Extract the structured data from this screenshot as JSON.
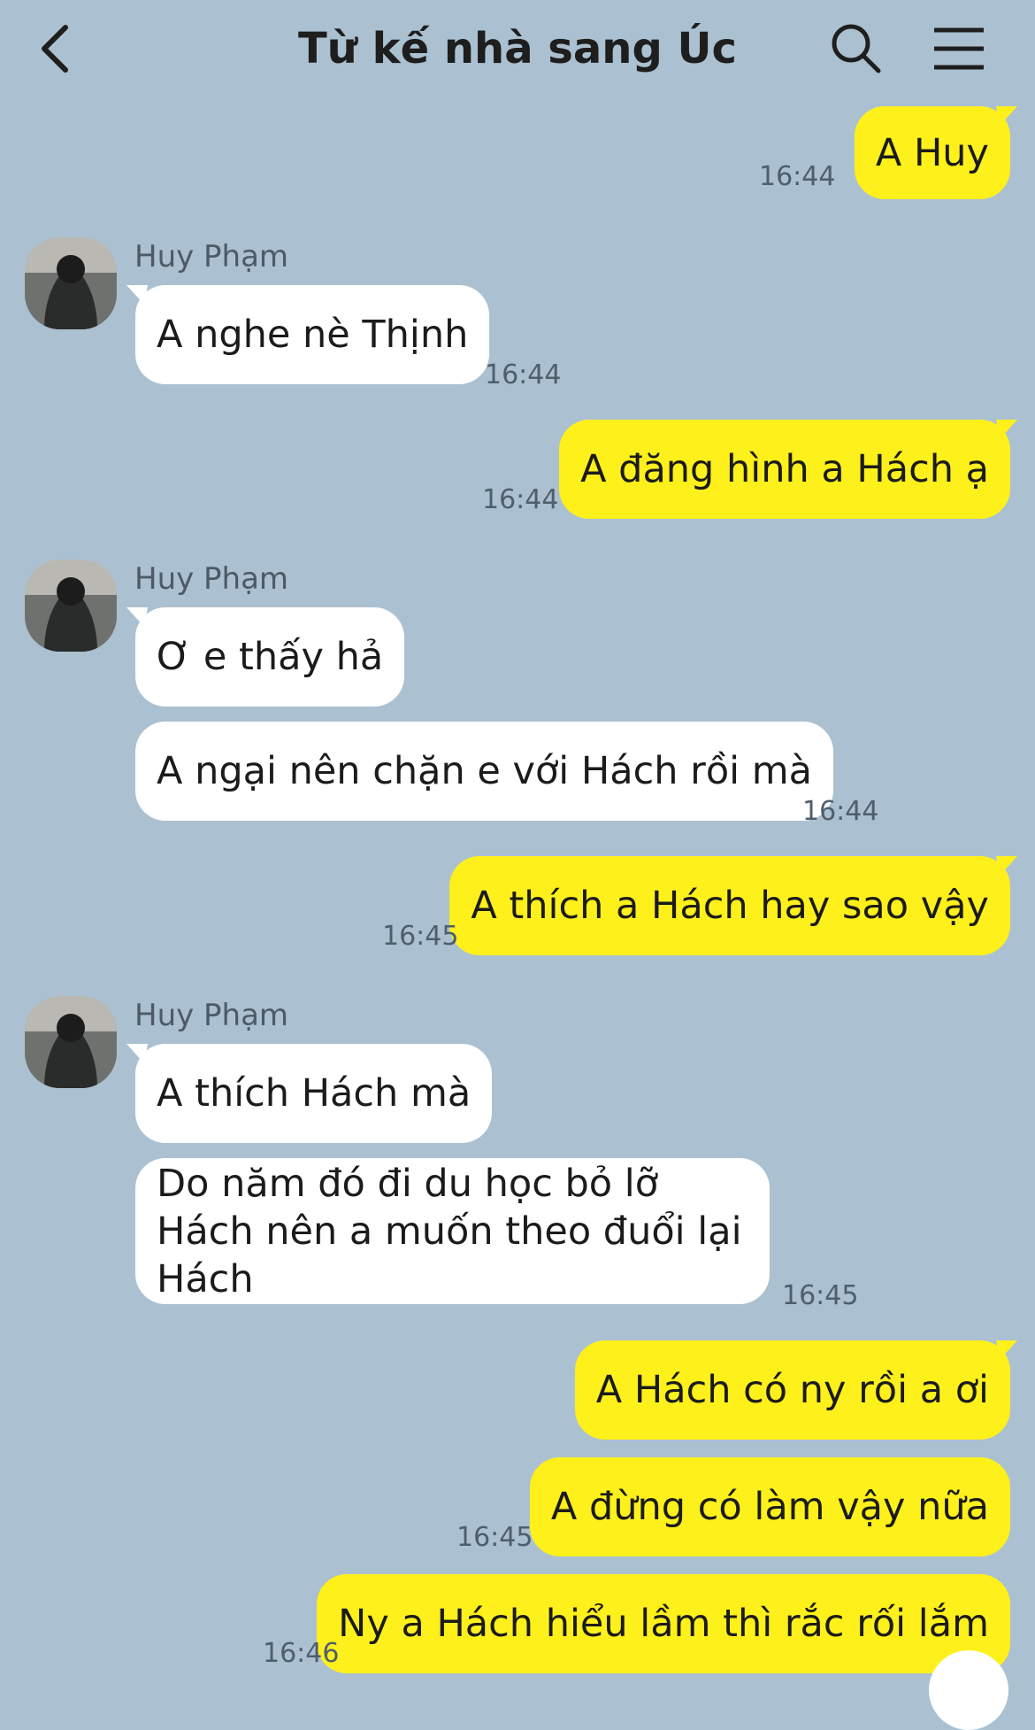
{
  "header": {
    "title": "Từ kế nhà sang Úc",
    "back_icon": "chevron-left-icon",
    "search_icon": "search-icon",
    "menu_icon": "hamburger-menu-icon"
  },
  "contact": {
    "name": "Huy Phạm"
  },
  "colors": {
    "background": "#abc1d1",
    "outgoing": "#fef01b",
    "incoming": "#ffffff"
  },
  "messages": [
    {
      "dir": "out",
      "text": "A Huy",
      "time": "16:44"
    },
    {
      "dir": "in",
      "text": "A nghe nè Thịnh",
      "time": "16:44"
    },
    {
      "dir": "out",
      "text": "A đăng hình a Hách ạ",
      "time": "16:44"
    },
    {
      "dir": "in",
      "text": "Ơ e thấy hả",
      "time": ""
    },
    {
      "dir": "in",
      "text": "A ngại nên chặn e với Hách rồi mà",
      "time": "16:44"
    },
    {
      "dir": "out",
      "text": "A thích a Hách hay sao vậy",
      "time": "16:45"
    },
    {
      "dir": "in",
      "text": "A thích Hách mà",
      "time": ""
    },
    {
      "dir": "in",
      "text": "Do năm đó đi du học bỏ lỡ Hách nên a muốn theo đuổi lại Hách",
      "time": "16:45"
    },
    {
      "dir": "out",
      "text": "A Hách có ny rồi a ơi",
      "time": ""
    },
    {
      "dir": "out",
      "text": "A đừng có làm vậy nữa",
      "time": "16:45"
    },
    {
      "dir": "out",
      "text": "Ny a Hách hiểu lầm thì rắc rối lắm",
      "time": "16:46"
    }
  ]
}
